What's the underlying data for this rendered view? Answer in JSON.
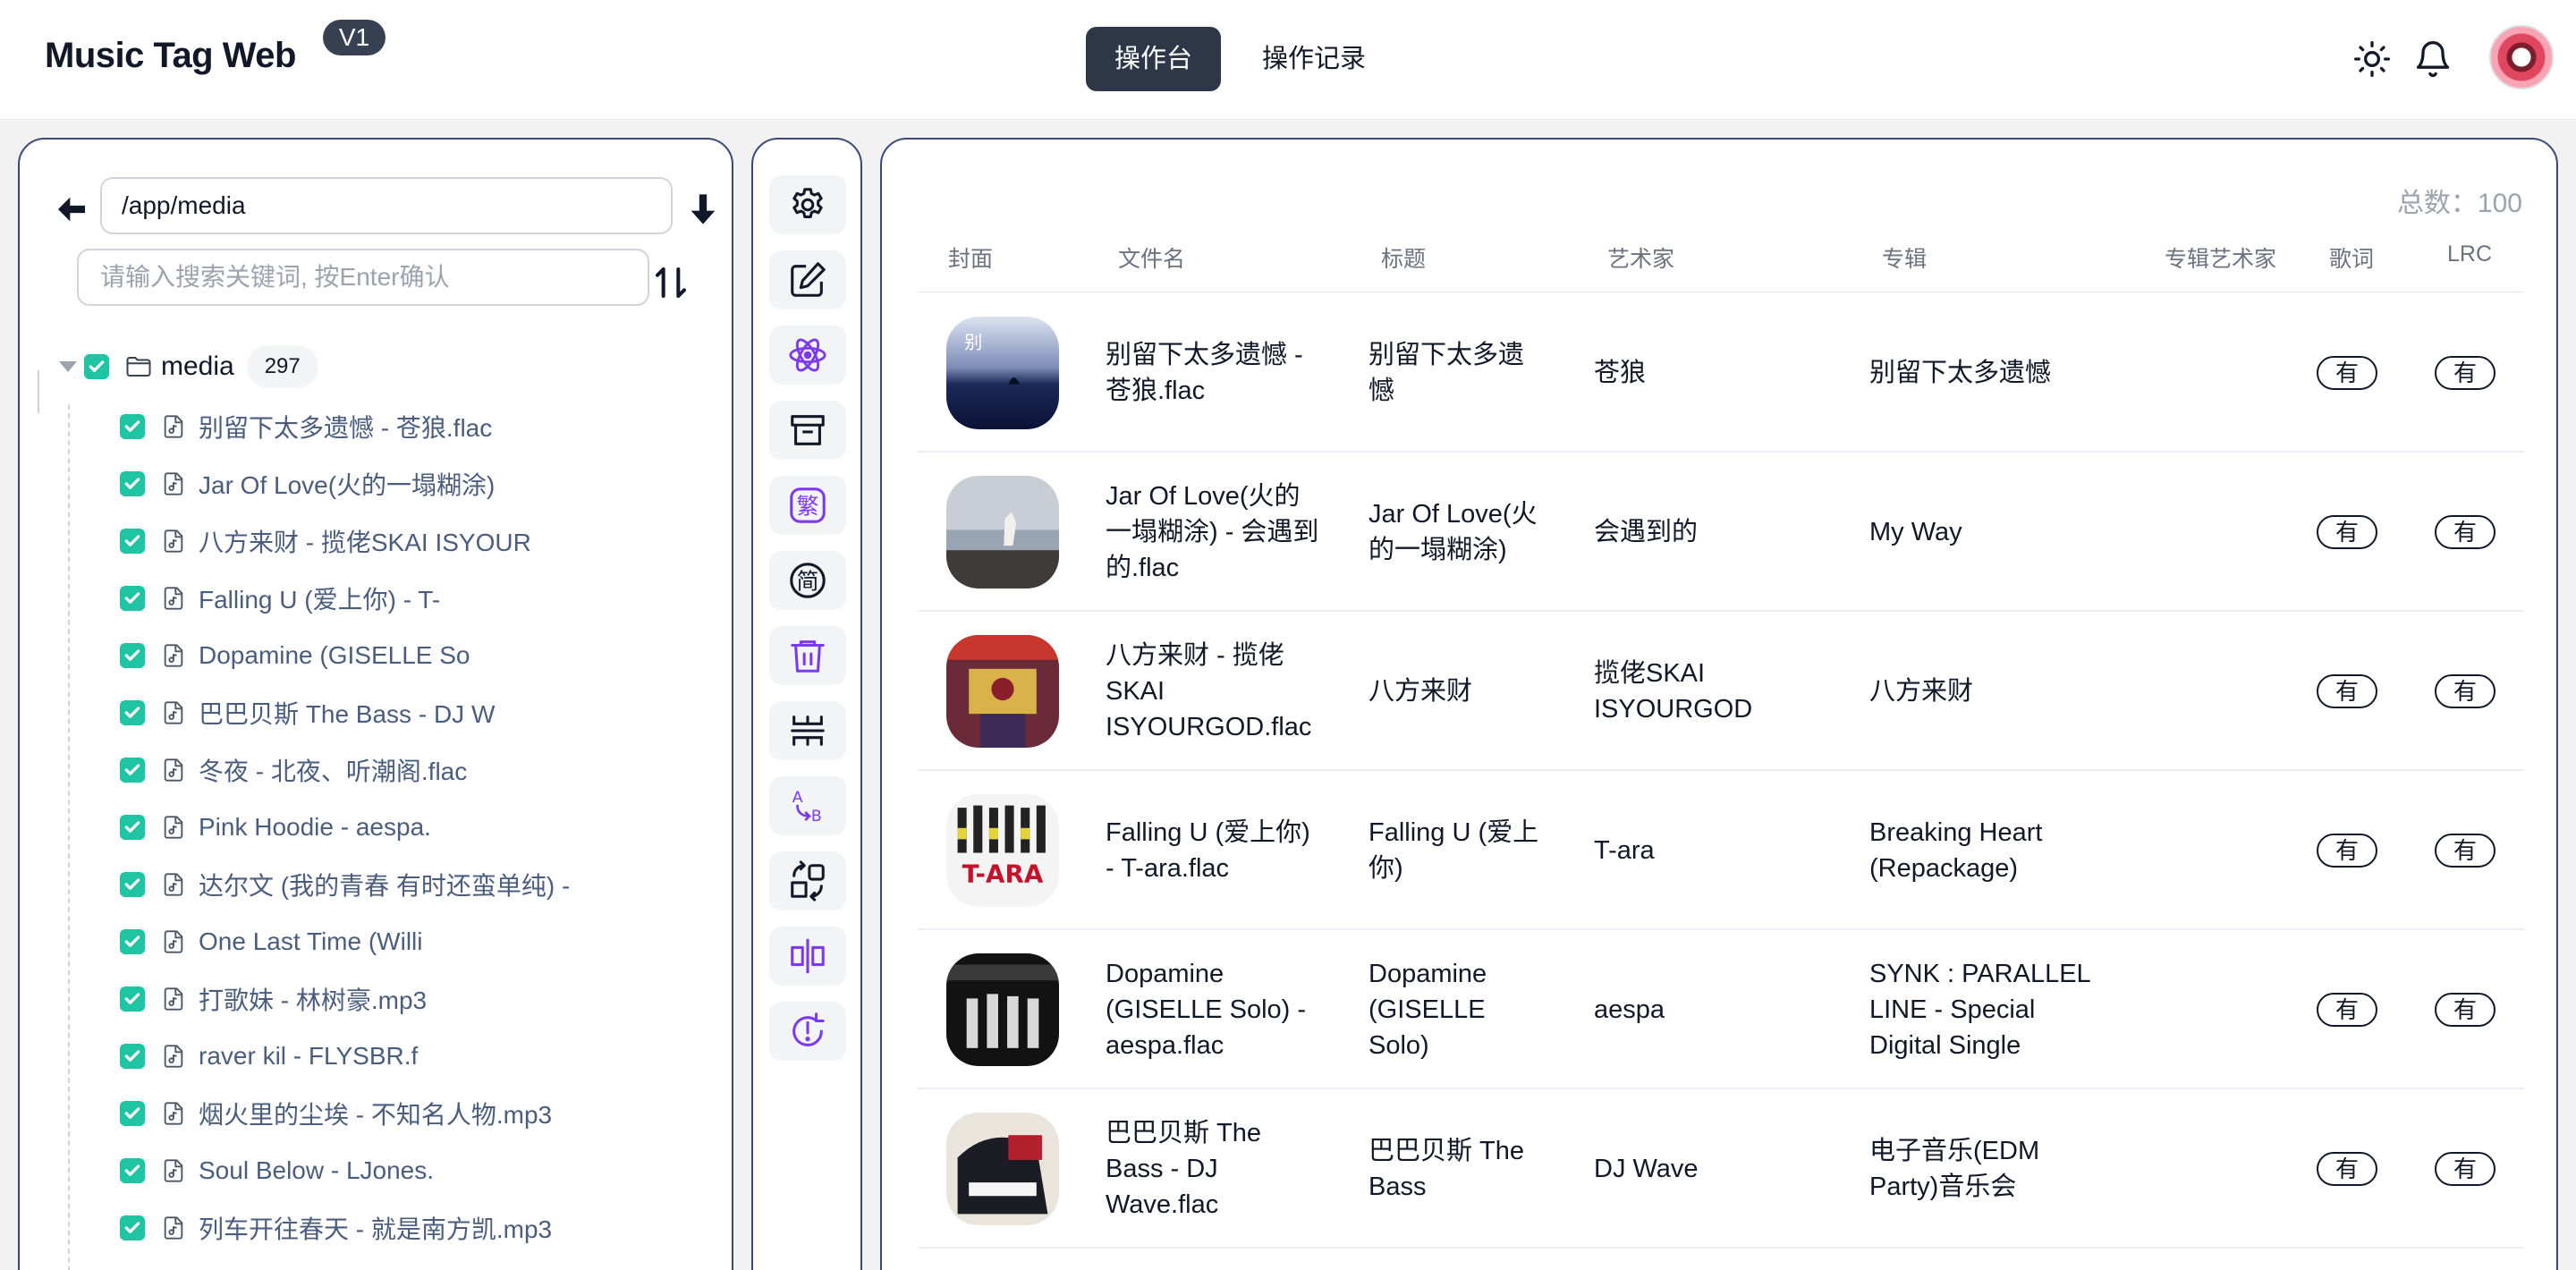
{
  "header": {
    "brand": "Music Tag Web",
    "version": "V1",
    "tabs": [
      {
        "label": "操作台",
        "active": true
      },
      {
        "label": "操作记录",
        "active": false
      }
    ],
    "icons": [
      "sun-icon",
      "bell-icon",
      "avatar"
    ]
  },
  "left": {
    "path_value": "/app/media",
    "search_placeholder": "请输入搜索关键词, 按Enter确认",
    "root": {
      "label": "media",
      "count": "297",
      "checked": true
    },
    "files": [
      "别留下太多遗憾 - 苍狼.flac",
      "Jar Of Love(火的一塌糊涂)",
      "八方来财 - 揽佬SKAI ISYOUR",
      "Falling U (爱上你) - T-",
      "Dopamine (GISELLE So",
      "巴巴贝斯 The Bass - DJ W",
      "冬夜 - 北夜、听潮阁.flac",
      "Pink Hoodie - aespa.",
      "达尔文 (我的青春 有时还蛮单纯) -",
      "One Last Time (Willi",
      "打歌妹 - 林树豪.mp3",
      "raver kil - FLYSBR.f",
      "烟火里的尘埃 - 不知名人物.mp3",
      "Soul Below - LJones.",
      "列车开往春天 - 就是南方凯.mp3"
    ]
  },
  "tools": [
    {
      "name": "settings-tool",
      "icon": "gear-icon",
      "color": "#111827"
    },
    {
      "name": "edit-tool",
      "icon": "edit-icon",
      "color": "#111827"
    },
    {
      "name": "atom-tool",
      "icon": "atom-icon",
      "color": "#7c3aed"
    },
    {
      "name": "archive-tool",
      "icon": "archive-icon",
      "color": "#111827"
    },
    {
      "name": "traditional-tool",
      "icon": "traditional-chinese-icon",
      "label": "繁",
      "color": "#7c3aed"
    },
    {
      "name": "simplified-tool",
      "icon": "simplified-chinese-icon",
      "label": "简",
      "color": "#111827"
    },
    {
      "name": "delete-tool",
      "icon": "trash-icon",
      "color": "#7c3aed"
    },
    {
      "name": "separator-tool",
      "icon": "separator-icon",
      "color": "#111827"
    },
    {
      "name": "rename-tool",
      "icon": "a-to-b-icon",
      "color": "#7c3aed"
    },
    {
      "name": "convert-tool",
      "icon": "convert-icon",
      "color": "#111827"
    },
    {
      "name": "split-tool",
      "icon": "split-icon",
      "color": "#7c3aed"
    },
    {
      "name": "refresh-tool",
      "icon": "refresh-icon",
      "color": "#7c3aed"
    }
  ],
  "table": {
    "total_label": "总数：100",
    "columns": [
      "封面",
      "文件名",
      "标题",
      "艺术家",
      "专辑",
      "专辑艺术家",
      "歌词",
      "LRC"
    ],
    "rows": [
      {
        "filename": "别留下太多遗憾 - 苍狼.flac",
        "title": "别留下太多遗憾",
        "artist": "苍狼",
        "album": "别留下太多遗憾",
        "album_artist": "",
        "lyrics": "有",
        "lrc": "有",
        "cover": "cover-night-sea"
      },
      {
        "filename": "Jar Of Love(火的一塌糊涂) - 会遇到的.flac",
        "title": "Jar Of Love(火的一塌糊涂)",
        "artist": "会遇到的",
        "album": "My Way",
        "album_artist": "",
        "lyrics": "有",
        "lrc": "有",
        "cover": "cover-beach"
      },
      {
        "filename": "八方来财 - 揽佬SKAI ISYOURGOD.flac",
        "title": "八方来财",
        "artist": "揽佬SKAI ISYOURGOD",
        "album": "八方来财",
        "album_artist": "",
        "lyrics": "有",
        "lrc": "有",
        "cover": "cover-temple"
      },
      {
        "filename": "Falling U (爱上你) - T-ara.flac",
        "title": "Falling U (爱上你)",
        "artist": "T-ara",
        "album": "Breaking Heart (Repackage)",
        "album_artist": "",
        "lyrics": "有",
        "lrc": "有",
        "cover": "cover-tara"
      },
      {
        "filename": "Dopamine (GISELLE Solo) - aespa.flac",
        "title": "Dopamine (GISELLE Solo)",
        "artist": "aespa",
        "album": "SYNK : PARALLEL LINE - Special Digital Single",
        "album_artist": "",
        "lyrics": "有",
        "lrc": "有",
        "cover": "cover-aespa"
      },
      {
        "filename": "巴巴贝斯 The Bass - DJ Wave.flac",
        "title": "巴巴贝斯 The Bass",
        "artist": "DJ Wave",
        "album": "电子音乐(EDM Party)音乐会",
        "album_artist": "",
        "lyrics": "有",
        "lrc": "有",
        "cover": "cover-bass"
      }
    ]
  }
}
